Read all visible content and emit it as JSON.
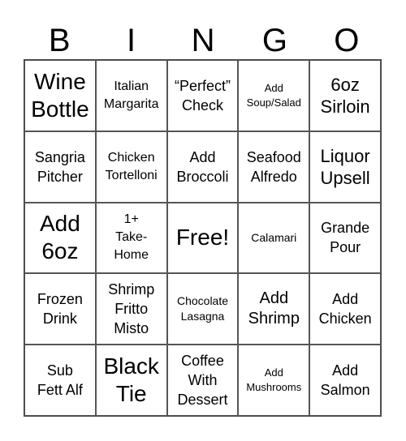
{
  "header": [
    "B",
    "I",
    "N",
    "G",
    "O"
  ],
  "cells": [
    {
      "text": "Wine\nBottle",
      "size": "s-xl"
    },
    {
      "text": "Italian\nMargarita",
      "size": "s-s"
    },
    {
      "text": "“Perfect”\nCheck",
      "size": "s-ms"
    },
    {
      "text": "Add\nSoup/Salad",
      "size": "s-xxs"
    },
    {
      "text": "6oz\nSirloin",
      "size": "s-l"
    },
    {
      "text": "Sangria\nPitcher",
      "size": "s-ms"
    },
    {
      "text": "Chicken\nTortelloni",
      "size": "s-s"
    },
    {
      "text": "Add\nBroccoli",
      "size": "s-ms"
    },
    {
      "text": "Seafood\nAlfredo",
      "size": "s-ms"
    },
    {
      "text": "Liquor\nUpsell",
      "size": "s-l"
    },
    {
      "text": "Add\n6oz",
      "size": "s-xl"
    },
    {
      "text": "1+\nTake-\nHome",
      "size": "s-s"
    },
    {
      "text": "Free!",
      "size": "s-free"
    },
    {
      "text": "Calamari",
      "size": "s-xs"
    },
    {
      "text": "Grande\nPour",
      "size": "s-ms"
    },
    {
      "text": "Frozen\nDrink",
      "size": "s-ms"
    },
    {
      "text": "Shrimp\nFritto\nMisto",
      "size": "s-ms"
    },
    {
      "text": "Chocolate\nLasagna",
      "size": "s-xs"
    },
    {
      "text": "Add\nShrimp",
      "size": "s-m"
    },
    {
      "text": "Add\nChicken",
      "size": "s-ms"
    },
    {
      "text": "Sub\nFett Alf",
      "size": "s-ms"
    },
    {
      "text": "Black\nTie",
      "size": "s-xl"
    },
    {
      "text": "Coffee\nWith\nDessert",
      "size": "s-ms"
    },
    {
      "text": "Add\nMushrooms",
      "size": "s-xxs"
    },
    {
      "text": "Add\nSalmon",
      "size": "s-ms"
    }
  ]
}
